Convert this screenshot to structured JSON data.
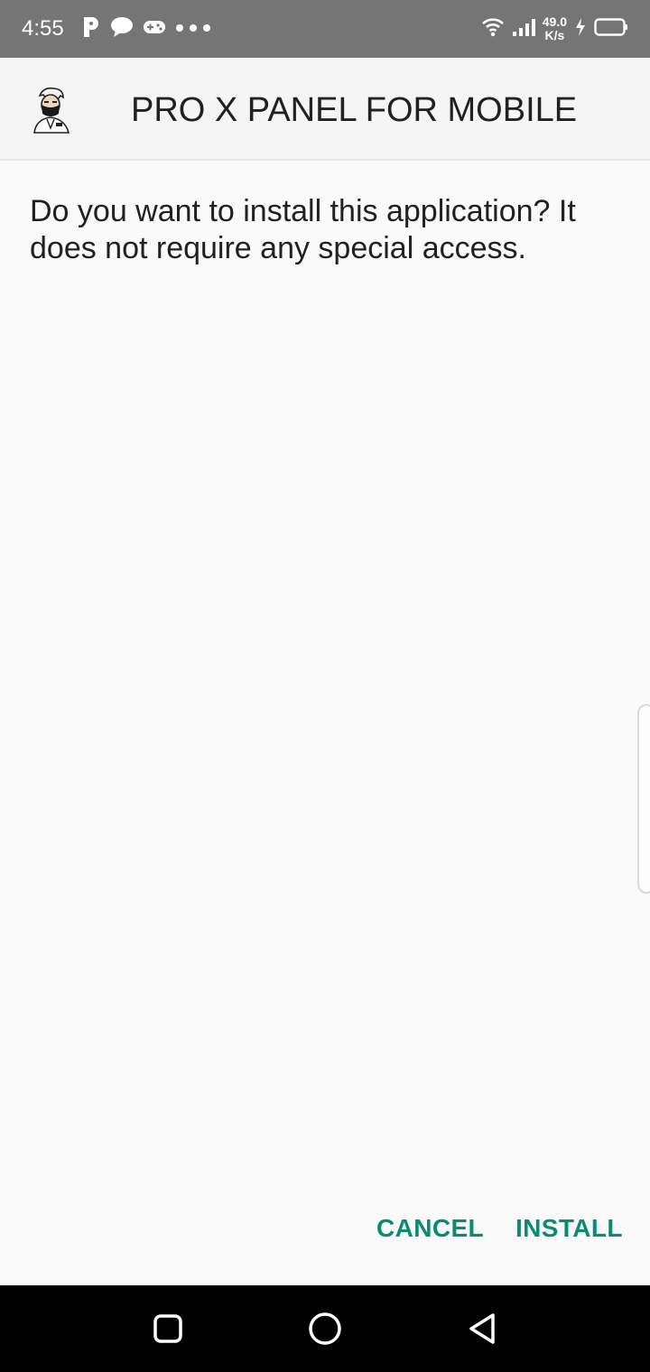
{
  "status_bar": {
    "time": "4:55",
    "notification_icons": [
      "p-icon",
      "chat-bubble-icon",
      "gamepad-icon",
      "more-dots-icon"
    ],
    "network_speed_value": "49.0",
    "network_speed_unit": "K/s",
    "right_icons": [
      "wifi-icon",
      "signal-icon",
      "charging-icon",
      "battery-icon"
    ]
  },
  "app": {
    "icon": "app-avatar-icon",
    "title": "PRO X PANEL FOR MOBILE"
  },
  "dialog": {
    "message": "Do you want to install this application? It does not require any special access."
  },
  "actions": {
    "cancel_label": "CANCEL",
    "install_label": "INSTALL"
  },
  "nav_bar": {
    "items": [
      "recents-icon",
      "home-icon",
      "back-icon"
    ]
  },
  "colors": {
    "status_bar": "#757575",
    "header_background": "#f5f5f5",
    "page_background": "#fafafa",
    "accent": "#0b8a74",
    "text": "#212121",
    "nav_bar": "#000000"
  }
}
